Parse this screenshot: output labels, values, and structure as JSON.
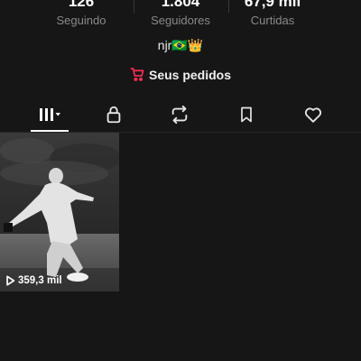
{
  "profile": {
    "stats": [
      {
        "value": "126",
        "label": "Seguindo"
      },
      {
        "value": "1.804",
        "label": "Seguidores"
      },
      {
        "value": "67,9 mil",
        "label": "Curtidas"
      }
    ],
    "bio": "njr🇧🇷👑",
    "orders_label": "Seus pedidos"
  },
  "tabs": [
    {
      "name": "videos",
      "icon": "grid-icon",
      "active": true
    },
    {
      "name": "private",
      "icon": "lock-icon",
      "active": false
    },
    {
      "name": "reposts",
      "icon": "repost-icon",
      "active": false
    },
    {
      "name": "favorites",
      "icon": "bookmark-icon",
      "active": false
    },
    {
      "name": "liked",
      "icon": "heart-icon",
      "active": false
    }
  ],
  "videos": [
    {
      "views": "359,3 mil"
    }
  ],
  "colors": {
    "background": "#161616",
    "accent_cart": "#fe2c55",
    "muted_label": "#8a8a8a"
  }
}
